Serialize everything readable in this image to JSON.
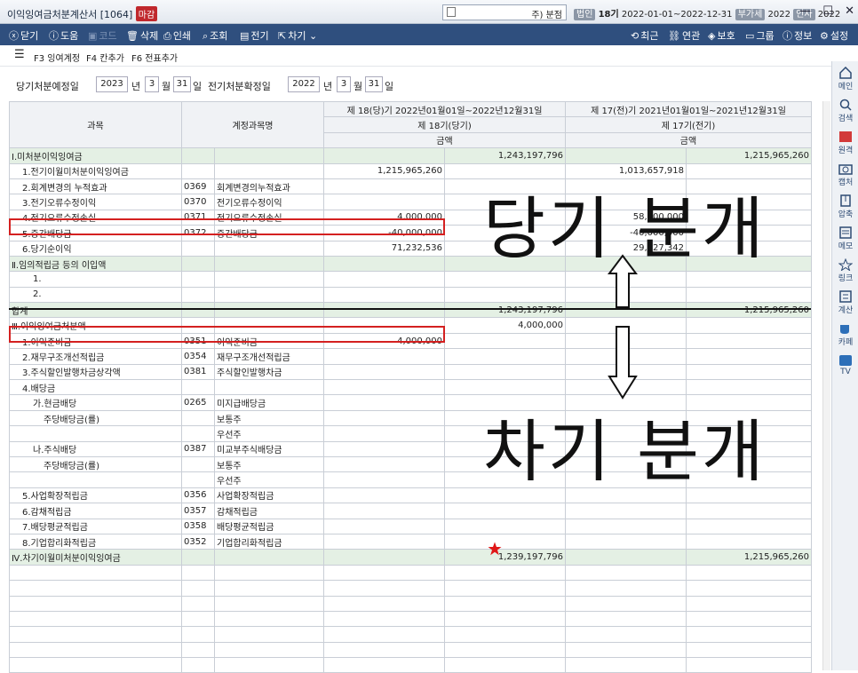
{
  "window": {
    "title": "이익잉여금처분계산서 [1064]",
    "badge": "마감",
    "company_name": "주) 분점",
    "badge_corp": "법인",
    "term": "18기",
    "period": "2022-01-01~2022-12-31",
    "badge_tax": "부가세",
    "tax_year": "2022",
    "badge_payroll": "인사",
    "payroll_year": "2022"
  },
  "toolbar": {
    "close": "닫기",
    "help": "도움",
    "code": "코드",
    "delete": "삭제",
    "print": "인쇄",
    "search": "조회",
    "ledger": "전기",
    "next": "차기",
    "recent": "최근",
    "link": "연관",
    "protect": "보호",
    "group": "그룹",
    "info": "정보",
    "settings": "설정"
  },
  "fkeys": {
    "f3": "F3 잉여계정",
    "f4": "F4 칸추가",
    "f6": "F6 전표추가"
  },
  "dates": {
    "cur_label": "당기처분예정일",
    "cur_year": "2023",
    "cur_month": "3",
    "cur_day": "31",
    "prev_label": "전기처분확정일",
    "prev_year": "2022",
    "prev_month": "3",
    "prev_day": "31",
    "year_unit": "년",
    "month_unit": "월",
    "day_unit": "일"
  },
  "table": {
    "h_subject": "과목",
    "h_account": "계정과목명",
    "h_cur_period": "제 18(당)기 2022년01월01일~2022년12월31일",
    "h_cur_term": "제 18기(당기)",
    "h_cur_amount": "금액",
    "h_prev_period": "제 17(전)기 2021년01월01일~2021년12월31일",
    "h_prev_term": "제 17기(전기)",
    "h_prev_amount": "금액",
    "rows": [
      {
        "s": "Ⅰ.미처분이익잉여금",
        "c": "",
        "a": "",
        "v1": "",
        "v2": "1,243,197,796",
        "v3": "",
        "v4": "1,215,965,260"
      },
      {
        "s": "1.전기이월미처분이익잉여금",
        "c": "",
        "a": "",
        "v1": "1,215,965,260",
        "v2": "",
        "v3": "1,013,657,918",
        "v4": ""
      },
      {
        "s": "2.회계변경의 누적효과",
        "c": "0369",
        "a": "회계변경의누적효과",
        "v1": "",
        "v2": "",
        "v3": "",
        "v4": ""
      },
      {
        "s": "3.전기오류수정이익",
        "c": "0370",
        "a": "전기오류수정이익",
        "v1": "",
        "v2": "",
        "v3": "",
        "v4": ""
      },
      {
        "s": "4.전기오류수정손실",
        "c": "0371",
        "a": "전기오류수정손실",
        "v1": "4,000,000",
        "v2": "",
        "v3": "58,500,000",
        "v4": ""
      },
      {
        "s": "5.중간배당금",
        "c": "0372",
        "a": "중간배당금",
        "v1": "-40,000,000",
        "v2": "",
        "v3": "-40,000,000",
        "v4": ""
      },
      {
        "s": "6.당기순이익",
        "c": "",
        "a": "",
        "v1": "71,232,536",
        "v2": "",
        "v3": "29,827,342",
        "v4": ""
      },
      {
        "s": "Ⅱ.임의적립금 등의 이입액",
        "c": "",
        "a": "",
        "v1": "",
        "v2": "",
        "v3": "",
        "v4": ""
      },
      {
        "s": "1.",
        "c": "",
        "a": "",
        "v1": "",
        "v2": "",
        "v3": "",
        "v4": ""
      },
      {
        "s": "2.",
        "c": "",
        "a": "",
        "v1": "",
        "v2": "",
        "v3": "",
        "v4": ""
      },
      {
        "s": "합계",
        "c": "",
        "a": "",
        "v1": "",
        "v2": "1,243,197,796",
        "v3": "",
        "v4": "1,215,965,260"
      },
      {
        "s": "Ⅲ.이익잉여금처분액",
        "c": "",
        "a": "",
        "v1": "",
        "v2": "4,000,000",
        "v3": "",
        "v4": ""
      },
      {
        "s": "1.이익준비금",
        "c": "0351",
        "a": "이익준비금",
        "v1": "4,000,000",
        "v2": "",
        "v3": "",
        "v4": ""
      },
      {
        "s": "2.재무구조개선적립금",
        "c": "0354",
        "a": "재무구조개선적립금",
        "v1": "",
        "v2": "",
        "v3": "",
        "v4": ""
      },
      {
        "s": "3.주식할인발행차금상각액",
        "c": "0381",
        "a": "주식할인발행차금",
        "v1": "",
        "v2": "",
        "v3": "",
        "v4": ""
      },
      {
        "s": "4.배당금",
        "c": "",
        "a": "",
        "v1": "",
        "v2": "",
        "v3": "",
        "v4": ""
      },
      {
        "s": "가.현금배당",
        "c": "0265",
        "a": "미지급배당금",
        "v1": "",
        "v2": "",
        "v3": "",
        "v4": ""
      },
      {
        "s": "주당배당금(률)",
        "c": "",
        "a": "보통주",
        "v1": "",
        "v2": "",
        "v3": "",
        "v4": ""
      },
      {
        "s": "",
        "c": "",
        "a": "우선주",
        "v1": "",
        "v2": "",
        "v3": "",
        "v4": ""
      },
      {
        "s": "나.주식배당",
        "c": "0387",
        "a": "미교부주식배당금",
        "v1": "",
        "v2": "",
        "v3": "",
        "v4": ""
      },
      {
        "s": "주당배당금(률)",
        "c": "",
        "a": "보통주",
        "v1": "",
        "v2": "",
        "v3": "",
        "v4": ""
      },
      {
        "s": "",
        "c": "",
        "a": "우선주",
        "v1": "",
        "v2": "",
        "v3": "",
        "v4": ""
      },
      {
        "s": "5.사업확장적립금",
        "c": "0356",
        "a": "사업확장적립금",
        "v1": "",
        "v2": "",
        "v3": "",
        "v4": ""
      },
      {
        "s": "6.감채적립금",
        "c": "0357",
        "a": "감채적립금",
        "v1": "",
        "v2": "",
        "v3": "",
        "v4": ""
      },
      {
        "s": "7.배당평균적립금",
        "c": "0358",
        "a": "배당평균적립금",
        "v1": "",
        "v2": "",
        "v3": "",
        "v4": ""
      },
      {
        "s": "8.기업합리화적립금",
        "c": "0352",
        "a": "기업합리화적립금",
        "v1": "",
        "v2": "",
        "v3": "",
        "v4": ""
      },
      {
        "s": "Ⅳ.차기이월미처분이익잉여금",
        "c": "",
        "a": "",
        "v1": "",
        "v2": "1,239,197,796",
        "v3": "",
        "v4": "1,215,965,260"
      }
    ]
  },
  "annotations": {
    "current": "당기 분개",
    "next": "차기 분개"
  },
  "sidebar": {
    "main": "메인",
    "search": "검색",
    "original": "원격",
    "capture": "캡처",
    "compress": "압축",
    "memo": "메모",
    "link": "링크",
    "calc": "계산",
    "talk": "카페",
    "tv": "TV"
  },
  "colors": {
    "toolbar": "#2f4f7e",
    "section": "#e4f0e4",
    "highlight": "#d42020",
    "badge_red": "#c0282d"
  }
}
